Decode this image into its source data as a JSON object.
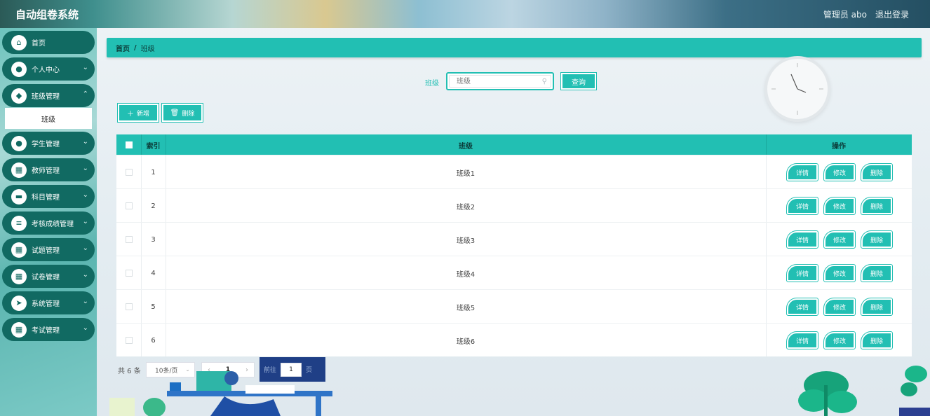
{
  "app": {
    "title": "自动组卷系统"
  },
  "header": {
    "user": "管理员 abo",
    "logout": "退出登录"
  },
  "sidebar": {
    "items": [
      {
        "label": "首页",
        "icon": "home-icon"
      },
      {
        "label": "个人中心",
        "icon": "person-icon"
      },
      {
        "label": "班级管理",
        "icon": "shield-icon"
      },
      {
        "label": "学生管理",
        "icon": "person-icon"
      },
      {
        "label": "教师管理",
        "icon": "grid-icon"
      },
      {
        "label": "科目管理",
        "icon": "wallet-icon"
      },
      {
        "label": "考核成绩管理",
        "icon": "list-icon"
      },
      {
        "label": "试题管理",
        "icon": "grid-icon"
      },
      {
        "label": "试卷管理",
        "icon": "grid-icon"
      },
      {
        "label": "系统管理",
        "icon": "send-icon"
      },
      {
        "label": "考试管理",
        "icon": "grid-icon"
      }
    ],
    "submenu": {
      "label": "班级"
    }
  },
  "breadcrumb": {
    "home": "首页",
    "separator": "/",
    "current": "班级"
  },
  "search": {
    "label": "班级",
    "placeholder": "班级",
    "button": "查询"
  },
  "actions": {
    "add": "新增",
    "delete": "删除"
  },
  "table": {
    "headers": {
      "index": "索引",
      "class": "班级",
      "ops": "操作"
    },
    "op_labels": {
      "detail": "详情",
      "edit": "修改",
      "delete": "删除"
    },
    "rows": [
      {
        "index": "1",
        "class": "班级1"
      },
      {
        "index": "2",
        "class": "班级2"
      },
      {
        "index": "3",
        "class": "班级3"
      },
      {
        "index": "4",
        "class": "班级4"
      },
      {
        "index": "5",
        "class": "班级5"
      },
      {
        "index": "6",
        "class": "班级6"
      }
    ]
  },
  "pagination": {
    "total": "共 6 条",
    "page_size": "10条/页",
    "current_page": "1",
    "goto_prefix": "前往",
    "goto_value": "1",
    "goto_suffix": "页"
  },
  "colors": {
    "accent": "#22bfb3",
    "sidebar_item": "#116a62"
  }
}
